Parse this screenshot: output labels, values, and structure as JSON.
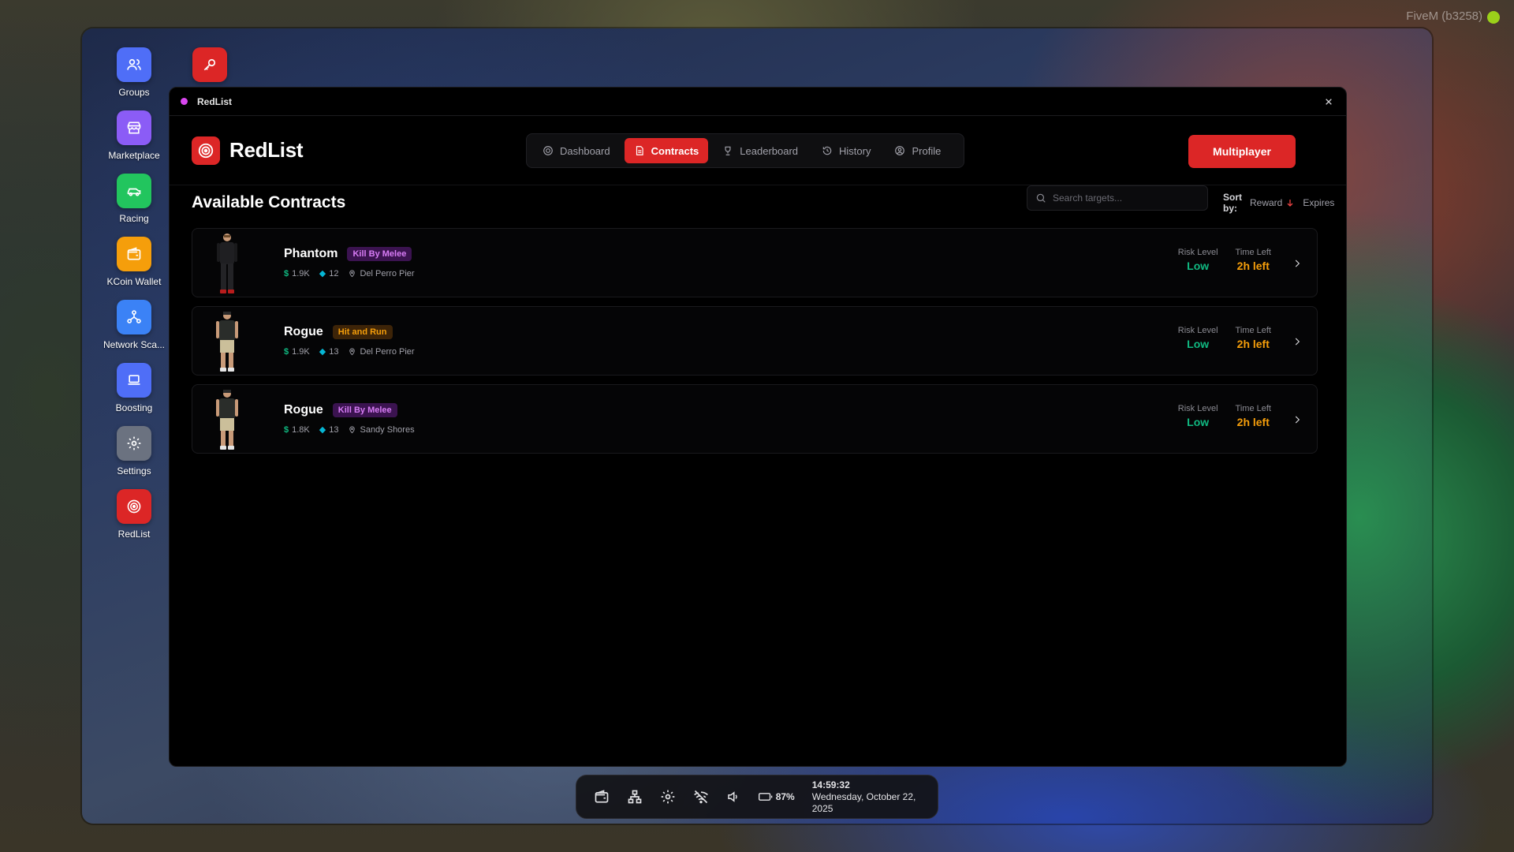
{
  "overlay": {
    "fivem_label": "FiveM (b3258)"
  },
  "dock": {
    "apps": [
      {
        "label": "Groups",
        "icon": "users-icon",
        "color": "#4f6ef7"
      },
      {
        "label": "Marketplace",
        "icon": "store-icon",
        "color": "#8b5cf6"
      },
      {
        "label": "Racing",
        "icon": "car-icon",
        "color": "#22c55e"
      },
      {
        "label": "KCoin Wallet",
        "icon": "wallet-icon",
        "color": "#f59e0b"
      },
      {
        "label": "Network Sca...",
        "icon": "network-icon",
        "color": "#3b82f6"
      },
      {
        "label": "Boosting",
        "icon": "laptop-icon",
        "color": "#4f6ef7"
      },
      {
        "label": "Settings",
        "icon": "gear-icon",
        "color": "#6b7280"
      },
      {
        "label": "RedList",
        "icon": "target-icon",
        "color": "#dc2626"
      }
    ],
    "extra_icon": "key-icon"
  },
  "window": {
    "title": "RedList",
    "brand": "RedList",
    "nav": [
      {
        "label": "Dashboard",
        "icon": "gauge-icon"
      },
      {
        "label": "Contracts",
        "icon": "document-icon",
        "active": true
      },
      {
        "label": "Leaderboard",
        "icon": "trophy-icon"
      },
      {
        "label": "History",
        "icon": "history-icon"
      },
      {
        "label": "Profile",
        "icon": "user-circle-icon"
      }
    ],
    "multiplayer_label": "Multiplayer"
  },
  "contracts_view": {
    "title": "Available Contracts",
    "search_placeholder": "Search targets...",
    "sort_label": "Sort by:",
    "sort_options": [
      "Reward",
      "Expires"
    ],
    "risk_label": "Risk Level",
    "time_label": "Time Left",
    "items": [
      {
        "name": "Phantom",
        "type": "Kill By Melee",
        "reward": "1.9K",
        "rep": "12",
        "location": "Del Perro Pier",
        "risk": "Low",
        "time_left": "2h left"
      },
      {
        "name": "Rogue",
        "type": "Hit and Run",
        "reward": "1.9K",
        "rep": "13",
        "location": "Del Perro Pier",
        "risk": "Low",
        "time_left": "2h left"
      },
      {
        "name": "Rogue",
        "type": "Kill By Melee",
        "reward": "1.8K",
        "rep": "13",
        "location": "Sandy Shores",
        "risk": "Low",
        "time_left": "2h left"
      }
    ]
  },
  "taskbar": {
    "battery": "87%",
    "time": "14:59:32",
    "date": "Wednesday, October 22, 2025"
  }
}
